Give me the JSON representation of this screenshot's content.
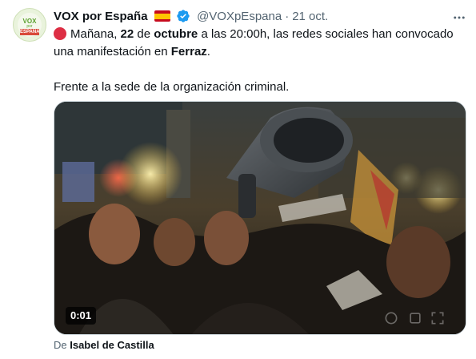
{
  "avatar": {
    "line1": "VOX",
    "line2": "por",
    "line3": "ESPAÑA"
  },
  "tweet": {
    "display_name": "VOX por España",
    "handle": "@VOXpEspana",
    "separator": "·",
    "date": "21 oct.",
    "line1": {
      "p1": "Mañana, ",
      "b1": "22",
      "p2": " de ",
      "b2": "octubre",
      "p3": " a las 20:00h, las redes sociales han convocado"
    },
    "line2": {
      "p1": "una manifestación en ",
      "b1": "Ferraz",
      "p2": "."
    },
    "line3": "Frente a la sede de la organización criminal."
  },
  "media": {
    "timestamp": "0:01",
    "source_prefix": "De ",
    "source_name": "Isabel de Castilla"
  },
  "icons": {
    "flag": "spain-flag-icon",
    "verified": "verified-badge-icon",
    "more": "more-options-icon",
    "alert": "red-circle-icon"
  },
  "colors": {
    "text": "#0f1419",
    "secondary": "#536471",
    "verified": "#1d9bf0",
    "alert_red": "#dd2e44"
  }
}
